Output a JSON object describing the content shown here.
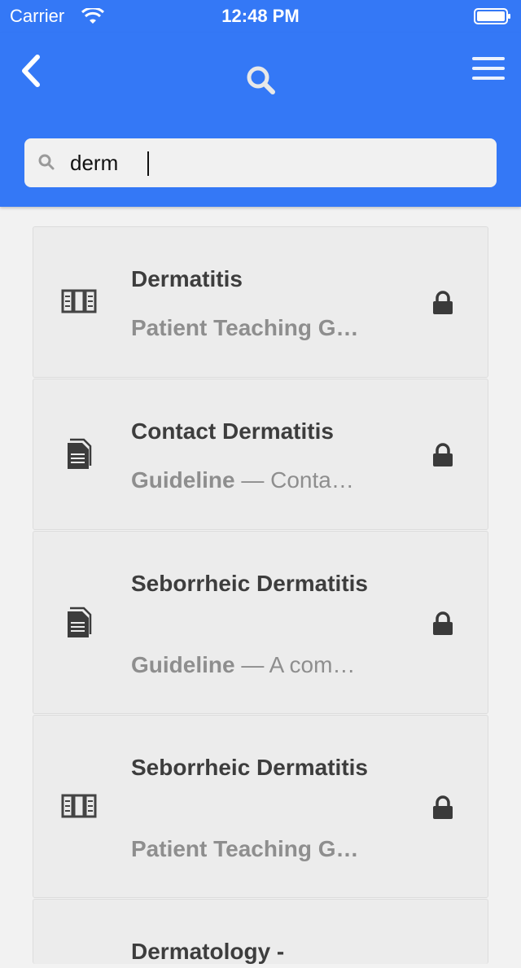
{
  "status_bar": {
    "carrier": "Carrier",
    "time": "12:48 PM"
  },
  "header": {
    "back_icon": "chevron-left-icon",
    "center_icon": "search-icon",
    "menu_icon": "hamburger-menu-icon"
  },
  "search": {
    "value": "derm",
    "placeholder": ""
  },
  "results": [
    {
      "title": "Dermatitis",
      "type": "Patient Teaching G…",
      "desc": "",
      "icon": "book-icon",
      "locked": true
    },
    {
      "title": "Contact Dermatitis",
      "type": "Guideline",
      "desc": "— Conta…",
      "icon": "document-icon",
      "locked": true
    },
    {
      "title": "Seborrheic Dermatitis",
      "type": "Guideline",
      "desc": "— A com…",
      "icon": "document-icon",
      "locked": true
    },
    {
      "title": "Seborrheic Dermatitis",
      "type": "Patient Teaching G…",
      "desc": "",
      "icon": "book-icon",
      "locked": true
    },
    {
      "title": "Dermatology -",
      "type": "",
      "desc": "",
      "icon": "",
      "locked": false
    }
  ]
}
